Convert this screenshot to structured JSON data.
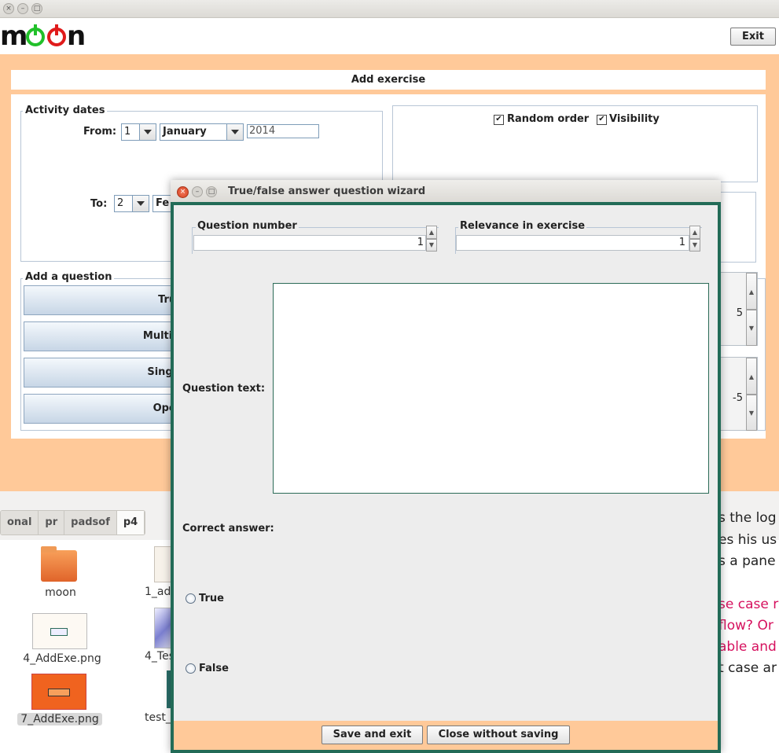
{
  "app": {
    "logo_text": "moon",
    "exit_label": "Exit"
  },
  "add_exercise": {
    "title": "Add exercise",
    "activity_dates_label": "Activity dates",
    "from_label": "From:",
    "from_day": "1",
    "from_month": "January",
    "from_year": "2014",
    "to_label": "To:",
    "to_day": "2",
    "to_month_partial": "Fe",
    "random_order_label": "Random order",
    "random_order_checked": true,
    "visibility_label": "Visibility",
    "visibility_checked": true,
    "add_question_label": "Add a question",
    "question_buttons": [
      "True",
      "Multipl",
      "Single",
      "Open"
    ],
    "spinner_values": [
      "5",
      "-5"
    ]
  },
  "file_manager": {
    "tabs": [
      "onal",
      "pr",
      "padsof",
      "p4"
    ],
    "files": [
      {
        "name": "moon"
      },
      {
        "name": "1_ad"
      },
      {
        "name": "4_AddExe.png"
      },
      {
        "name": "4_Tes"
      },
      {
        "name": "7_AddExe.png"
      },
      {
        "name": "test_"
      }
    ],
    "doc_lines": [
      {
        "text": "s the log",
        "color": "black"
      },
      {
        "text": "es his us",
        "color": "black"
      },
      {
        "text": "s a pane",
        "color": "black"
      },
      {
        "text": "se case r",
        "color": "pink"
      },
      {
        "text": "flow? Or",
        "color": "pink"
      },
      {
        "text": "able and",
        "color": "pink"
      },
      {
        "text": "t case ar",
        "color": "black"
      }
    ]
  },
  "wizard": {
    "title": "True/false answer question wizard",
    "question_number_label": "Question number",
    "question_number_value": "1",
    "relevance_label": "Relevance in exercise",
    "relevance_value": "1",
    "question_text_label": "Question text:",
    "question_text_value": "",
    "correct_answer_label": "Correct answer:",
    "true_label": "True",
    "false_label": "False",
    "save_label": "Save and exit",
    "close_label": "Close without saving"
  },
  "colors": {
    "window_bg": "#ffc999",
    "dialog_frame": "#226b57",
    "link_pink": "#d6115e",
    "logo_green": "#22c02a",
    "logo_red": "#e01b1b"
  }
}
